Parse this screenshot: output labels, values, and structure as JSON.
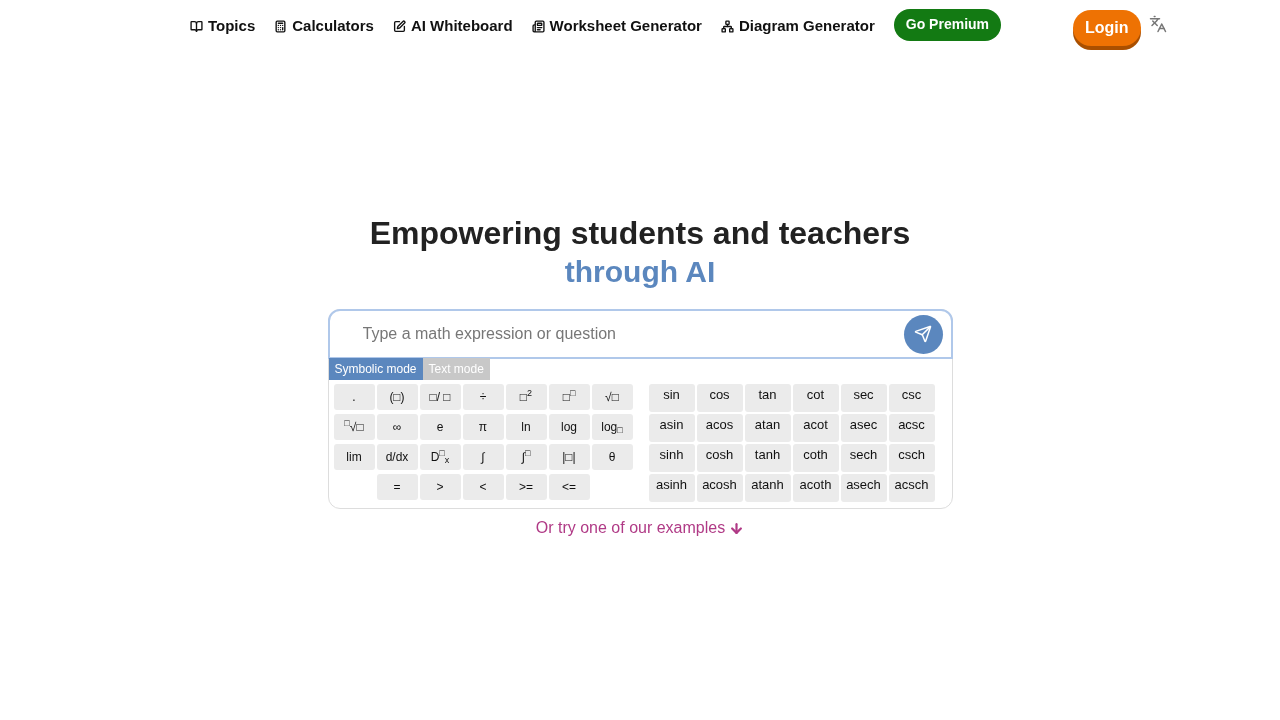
{
  "nav": [
    {
      "label": "Topics"
    },
    {
      "label": "Calculators"
    },
    {
      "label": "AI Whiteboard"
    },
    {
      "label": "Worksheet Generator"
    },
    {
      "label": "Diagram Generator"
    }
  ],
  "premium": "Go Premium",
  "login": "Login",
  "headline": "Empowering students and teachers",
  "headline_accent": "through AI",
  "search": {
    "placeholder": "Type a math expression or question"
  },
  "modes": [
    {
      "label": "Symbolic mode",
      "selected": true
    },
    {
      "label": "Text mode",
      "selected": false
    }
  ],
  "symbol_rows": [
    {
      "indent": false,
      "keys": [
        ".",
        "(□)",
        "□/ □",
        "÷",
        "□$^{2}$",
        "□$^{□}$",
        "√□"
      ]
    },
    {
      "indent": false,
      "keys": [
        "$^{□}$√□",
        "∞",
        "e",
        "π",
        "ln",
        "log",
        "log$_{□}$"
      ]
    },
    {
      "indent": false,
      "keys": [
        "lim",
        "d/dx",
        "D$^{□}$$_{x}$",
        "∫",
        "∫$^{□}$",
        "|□|",
        "θ"
      ]
    },
    {
      "indent": true,
      "keys": [
        "=",
        ">",
        "<",
        ">=",
        "<="
      ]
    }
  ],
  "function_rows": [
    [
      "sin",
      "cos",
      "tan",
      "cot",
      "sec",
      "csc"
    ],
    [
      "asin",
      "acos",
      "atan",
      "acot",
      "asec",
      "acsc"
    ],
    [
      "sinh",
      "cosh",
      "tanh",
      "coth",
      "sech",
      "csch"
    ],
    [
      "asinh",
      "acosh",
      "atanh",
      "acoth",
      "asech",
      "acsch"
    ]
  ],
  "examples_link": "Or try one of our examples"
}
